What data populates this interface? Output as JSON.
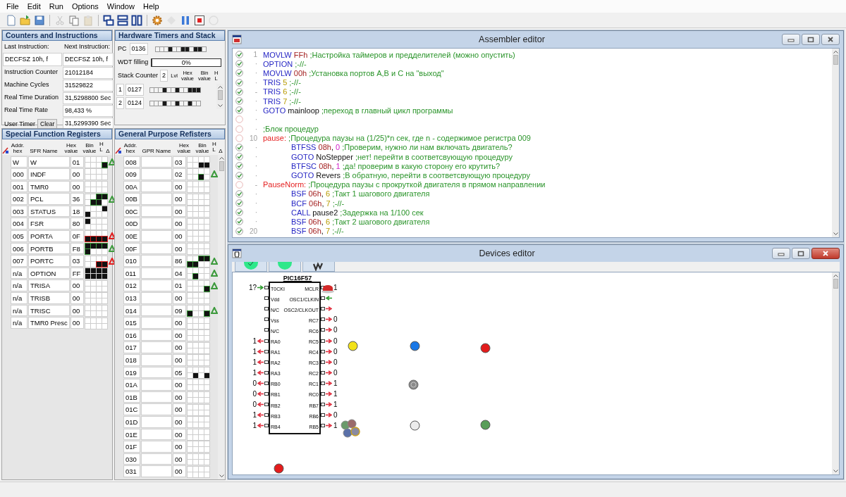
{
  "menu": [
    "File",
    "Edit",
    "Run",
    "Options",
    "Window",
    "Help"
  ],
  "toolbar": [
    {
      "kind": "new",
      "disabled": false
    },
    {
      "kind": "open",
      "disabled": false
    },
    {
      "kind": "save",
      "disabled": false
    },
    {
      "kind": "separator"
    },
    {
      "kind": "cut",
      "disabled": true
    },
    {
      "kind": "copy",
      "disabled": false
    },
    {
      "kind": "paste",
      "disabled": true
    },
    {
      "kind": "separator"
    },
    {
      "kind": "cascade",
      "disabled": false
    },
    {
      "kind": "tile_h",
      "disabled": false
    },
    {
      "kind": "tile_v",
      "disabled": false
    },
    {
      "kind": "separator"
    },
    {
      "kind": "settings",
      "disabled": false
    },
    {
      "kind": "step",
      "disabled": true
    },
    {
      "kind": "pause",
      "disabled": false
    },
    {
      "kind": "record",
      "disabled": false
    },
    {
      "kind": "info",
      "disabled": true
    }
  ],
  "counters": {
    "title": "Counters and Instructions",
    "last_label": "Last Instruction:",
    "next_label": "Next Instruction:",
    "last_value": "DECFSZ 10h, f",
    "next_value": "DECFSZ 10h, f",
    "rows": [
      {
        "label": "Instruction Counter",
        "value": "21012184"
      },
      {
        "label": "Machine Cycles",
        "value": "31529822"
      },
      {
        "label": "Real Time Duration",
        "value": "31,5298800 Sec"
      },
      {
        "label": "Real Time Rate",
        "value": "98,433 %"
      }
    ],
    "user_timer": {
      "label": "User Timer",
      "button": "Clear",
      "value": "31,5299390 Sec"
    }
  },
  "hardware": {
    "title": "Hardware Timers and Stack",
    "pc_label": "PC",
    "pc_value": "0136",
    "pc_bits": [
      false,
      false,
      false,
      true,
      false,
      false,
      true,
      true,
      false,
      true,
      true,
      false
    ],
    "wdt": {
      "label": "WDT filling",
      "level": 0,
      "reading": "0%"
    },
    "stack_label": "Stack Counter",
    "stack_count": "2",
    "headers": [
      "Lvl",
      "Hex value",
      "Bin value",
      "H L"
    ],
    "stack": [
      {
        "level_text": "1",
        "value": "0127",
        "bits": [
          false,
          false,
          false,
          true,
          false,
          false,
          true,
          false,
          false,
          true,
          true,
          true
        ]
      },
      {
        "level_text": "2",
        "value": "0124",
        "bits": [
          false,
          false,
          false,
          true,
          false,
          false,
          true,
          false,
          false,
          true,
          false,
          false
        ]
      }
    ]
  },
  "sfr": {
    "title": "Special Function Registers",
    "headers": [
      "Addr. hex",
      "SFR Name",
      "Hex value",
      "Bin value",
      "H L",
      "Δ"
    ],
    "rows": [
      {
        "addr": "W",
        "name": "W",
        "hex": "01",
        "bits": [
          false,
          false,
          false,
          false,
          false,
          false,
          false,
          true
        ],
        "changed": true,
        "color": "#3c9a3c"
      },
      {
        "addr": "000",
        "name": "INDF",
        "hex": "00",
        "bits": [
          false,
          false,
          false,
          false,
          false,
          false,
          false,
          false
        ],
        "changed": false
      },
      {
        "addr": "001",
        "name": "TMR0",
        "hex": "00",
        "bits": [
          false,
          false,
          false,
          false,
          false,
          false,
          false,
          false
        ],
        "changed": false
      },
      {
        "addr": "002",
        "name": "PCL",
        "hex": "36",
        "bits": [
          false,
          false,
          true,
          true,
          false,
          true,
          true,
          false
        ],
        "changed": true,
        "color": "#3c9a3c"
      },
      {
        "addr": "003",
        "name": "STATUS",
        "hex": "18",
        "bits": [
          false,
          false,
          false,
          true,
          true,
          false,
          false,
          false
        ],
        "changed": false
      },
      {
        "addr": "004",
        "name": "FSR",
        "hex": "80",
        "bits": [
          true,
          false,
          false,
          false,
          false,
          false,
          false,
          false
        ],
        "changed": false
      },
      {
        "addr": "005",
        "name": "PORTA",
        "hex": "0F",
        "bits": [
          false,
          false,
          false,
          false,
          true,
          true,
          true,
          true
        ],
        "changed": true,
        "color": "#e02020"
      },
      {
        "addr": "006",
        "name": "PORTB",
        "hex": "F8",
        "bits": [
          true,
          true,
          true,
          true,
          true,
          false,
          false,
          false
        ],
        "changed": true,
        "color": "#3c9a3c"
      },
      {
        "addr": "007",
        "name": "PORTC",
        "hex": "03",
        "bits": [
          false,
          false,
          false,
          false,
          false,
          false,
          true,
          true
        ],
        "changed": true,
        "color": "#e02020"
      },
      {
        "addr": "n/a",
        "name": "OPTION",
        "hex": "FF",
        "bits": [
          true,
          true,
          true,
          true,
          true,
          true,
          true,
          true
        ],
        "changed": false
      },
      {
        "addr": "n/a",
        "name": "TRISA",
        "hex": "00",
        "bits": [
          false,
          false,
          false,
          false,
          false,
          false,
          false,
          false
        ],
        "changed": false
      },
      {
        "addr": "n/a",
        "name": "TRISB",
        "hex": "00",
        "bits": [
          false,
          false,
          false,
          false,
          false,
          false,
          false,
          false
        ],
        "changed": false
      },
      {
        "addr": "n/a",
        "name": "TRISC",
        "hex": "00",
        "bits": [
          false,
          false,
          false,
          false,
          false,
          false,
          false,
          false
        ],
        "changed": false
      },
      {
        "addr": "n/a",
        "name": "TMR0 Presc",
        "hex": "00",
        "bits": [
          false,
          false,
          false,
          false,
          false,
          false,
          false,
          false
        ],
        "changed": false
      }
    ]
  },
  "gpr": {
    "title": "General Purpose Refisters",
    "headers": [
      "Addr. hex",
      "GPR Name",
      "Hex value",
      "Bin value",
      "H L",
      "Δ"
    ],
    "rows": [
      {
        "addr": "008",
        "hex": "03",
        "bits": [
          false,
          false,
          false,
          false,
          false,
          false,
          true,
          true
        ],
        "changed": false
      },
      {
        "addr": "009",
        "hex": "02",
        "bits": [
          false,
          false,
          false,
          false,
          false,
          false,
          true,
          false
        ],
        "changed": true,
        "color": "#3c9a3c"
      },
      {
        "addr": "00A",
        "hex": "00",
        "bits": [
          false,
          false,
          false,
          false,
          false,
          false,
          false,
          false
        ],
        "changed": false
      },
      {
        "addr": "00B",
        "hex": "00",
        "bits": [
          false,
          false,
          false,
          false,
          false,
          false,
          false,
          false
        ],
        "changed": false
      },
      {
        "addr": "00C",
        "hex": "00",
        "bits": [
          false,
          false,
          false,
          false,
          false,
          false,
          false,
          false
        ],
        "changed": false
      },
      {
        "addr": "00D",
        "hex": "00",
        "bits": [
          false,
          false,
          false,
          false,
          false,
          false,
          false,
          false
        ],
        "changed": false
      },
      {
        "addr": "00E",
        "hex": "00",
        "bits": [
          false,
          false,
          false,
          false,
          false,
          false,
          false,
          false
        ],
        "changed": false
      },
      {
        "addr": "00F",
        "hex": "00",
        "bits": [
          false,
          false,
          false,
          false,
          false,
          false,
          false,
          false
        ],
        "changed": false
      },
      {
        "addr": "010",
        "hex": "86",
        "bits": [
          false,
          false,
          true,
          true,
          true,
          true,
          false,
          false
        ],
        "changed": true,
        "color": "#3c9a3c"
      },
      {
        "addr": "011",
        "hex": "04",
        "bits": [
          false,
          false,
          false,
          false,
          false,
          true,
          false,
          false
        ],
        "changed": true,
        "color": "#3c9a3c"
      },
      {
        "addr": "012",
        "hex": "01",
        "bits": [
          false,
          false,
          false,
          false,
          false,
          false,
          false,
          true
        ],
        "changed": true,
        "color": "#3c9a3c"
      },
      {
        "addr": "013",
        "hex": "00",
        "bits": [
          false,
          false,
          false,
          false,
          false,
          false,
          false,
          false
        ],
        "changed": false
      },
      {
        "addr": "014",
        "hex": "09",
        "bits": [
          false,
          false,
          false,
          false,
          true,
          false,
          false,
          true
        ],
        "changed": true,
        "color": "#3c9a3c"
      },
      {
        "addr": "015",
        "hex": "00",
        "bits": [
          false,
          false,
          false,
          false,
          false,
          false,
          false,
          false
        ],
        "changed": false
      },
      {
        "addr": "016",
        "hex": "00",
        "bits": [
          false,
          false,
          false,
          false,
          false,
          false,
          false,
          false
        ],
        "changed": false
      },
      {
        "addr": "017",
        "hex": "00",
        "bits": [
          false,
          false,
          false,
          false,
          false,
          false,
          false,
          false
        ],
        "changed": false
      },
      {
        "addr": "018",
        "hex": "00",
        "bits": [
          false,
          false,
          false,
          false,
          false,
          false,
          false,
          false
        ],
        "changed": false
      },
      {
        "addr": "019",
        "hex": "05",
        "bits": [
          false,
          false,
          false,
          false,
          false,
          true,
          false,
          true
        ],
        "changed": false
      },
      {
        "addr": "01A",
        "hex": "00",
        "bits": [
          false,
          false,
          false,
          false,
          false,
          false,
          false,
          false
        ],
        "changed": false
      },
      {
        "addr": "01B",
        "hex": "00",
        "bits": [
          false,
          false,
          false,
          false,
          false,
          false,
          false,
          false
        ],
        "changed": false
      },
      {
        "addr": "01C",
        "hex": "00",
        "bits": [
          false,
          false,
          false,
          false,
          false,
          false,
          false,
          false
        ],
        "changed": false
      },
      {
        "addr": "01D",
        "hex": "00",
        "bits": [
          false,
          false,
          false,
          false,
          false,
          false,
          false,
          false
        ],
        "changed": false
      },
      {
        "addr": "01E",
        "hex": "00",
        "bits": [
          false,
          false,
          false,
          false,
          false,
          false,
          false,
          false
        ],
        "changed": false
      },
      {
        "addr": "01F",
        "hex": "00",
        "bits": [
          false,
          false,
          false,
          false,
          false,
          false,
          false,
          false
        ],
        "changed": false
      },
      {
        "addr": "030",
        "hex": "00",
        "bits": [
          false,
          false,
          false,
          false,
          false,
          false,
          false,
          false
        ],
        "changed": false
      },
      {
        "addr": "031",
        "hex": "00",
        "bits": [
          false,
          false,
          false,
          false,
          false,
          false,
          false,
          false
        ],
        "changed": false
      }
    ]
  },
  "assembler": {
    "title": "Assembler editor",
    "active": false,
    "lines": [
      {
        "compiled": true,
        "number": "1",
        "indent": false,
        "tokens": [
          {
            "kind": "op",
            "text": "MOVLW "
          },
          {
            "kind": "reg",
            "text": "FFh "
          },
          {
            "kind": "comment",
            "text": ";Настройка таймеров и предделителей (можно опустить)"
          }
        ]
      },
      {
        "compiled": true,
        "number": "·",
        "indent": false,
        "tokens": [
          {
            "kind": "op",
            "text": "OPTION "
          },
          {
            "kind": "comment",
            "text": ";-//-"
          }
        ]
      },
      {
        "compiled": true,
        "number": "·",
        "indent": false,
        "tokens": [
          {
            "kind": "op",
            "text": "MOVLW "
          },
          {
            "kind": "reg",
            "text": "00h "
          },
          {
            "kind": "comment",
            "text": ";Установка портов A,B и C на \"выход\""
          }
        ]
      },
      {
        "compiled": true,
        "number": "·",
        "indent": false,
        "tokens": [
          {
            "kind": "op",
            "text": "TRIS "
          },
          {
            "kind": "lit",
            "text": "5 "
          },
          {
            "kind": "comment",
            "text": ";-//-"
          }
        ]
      },
      {
        "compiled": true,
        "number": "-",
        "indent": false,
        "tokens": [
          {
            "kind": "op",
            "text": "TRIS "
          },
          {
            "kind": "lit",
            "text": "6 "
          },
          {
            "kind": "comment",
            "text": ";-//-"
          }
        ]
      },
      {
        "compiled": true,
        "number": "·",
        "indent": false,
        "tokens": [
          {
            "kind": "op",
            "text": "TRIS "
          },
          {
            "kind": "lit",
            "text": "7 "
          },
          {
            "kind": "comment",
            "text": ";-//-"
          }
        ]
      },
      {
        "compiled": true,
        "number": "·",
        "indent": false,
        "tokens": [
          {
            "kind": "op",
            "text": "GOTO "
          },
          {
            "kind": "ident",
            "text": "mainloop "
          },
          {
            "kind": "comment",
            "text": ";переход в главный цикл программы"
          }
        ]
      },
      {
        "compiled": false,
        "number": "·"
      },
      {
        "compiled": false,
        "number": "·",
        "indent": false,
        "tokens": [
          {
            "kind": "comment",
            "text": ";Блок процедур"
          }
        ]
      },
      {
        "compiled": false,
        "number": "10",
        "indent": false,
        "tokens": [
          {
            "kind": "label",
            "text": "pause: "
          },
          {
            "kind": "comment",
            "text": ";Процедура паузы на (1/25)*n сек, где n - содержимое регистра 009"
          }
        ]
      },
      {
        "compiled": true,
        "number": "·",
        "indent": true,
        "tokens": [
          {
            "kind": "op",
            "text": "BTFSS "
          },
          {
            "kind": "reg",
            "text": "08h"
          },
          {
            "kind": "text",
            "text": ", "
          },
          {
            "kind": "bit",
            "text": "0 "
          },
          {
            "kind": "comment",
            "text": ";Проверим, нужно ли нам включать двигатель?"
          }
        ]
      },
      {
        "compiled": true,
        "number": "·",
        "indent": true,
        "tokens": [
          {
            "kind": "op",
            "text": "GOTO "
          },
          {
            "kind": "ident",
            "text": "NoStepper "
          },
          {
            "kind": "comment",
            "text": ";нет! перейти в соответсвующую процедуру"
          }
        ]
      },
      {
        "compiled": true,
        "number": "·",
        "indent": true,
        "tokens": [
          {
            "kind": "op",
            "text": "BTFSC "
          },
          {
            "kind": "reg",
            "text": "08h"
          },
          {
            "kind": "text",
            "text": ", "
          },
          {
            "kind": "bit",
            "text": "1 "
          },
          {
            "kind": "comment",
            "text": ";да! проверим в какую сторону его крутить?"
          }
        ]
      },
      {
        "compiled": true,
        "number": "·",
        "indent": true,
        "tokens": [
          {
            "kind": "op",
            "text": "GOTO "
          },
          {
            "kind": "ident",
            "text": "Revers "
          },
          {
            "kind": "comment",
            "text": ";В обратную, перейти в соответсвующую процедуру"
          }
        ]
      },
      {
        "compiled": false,
        "number": "-",
        "indent": false,
        "tokens": [
          {
            "kind": "label",
            "text": "PauseNorm: "
          },
          {
            "kind": "comment",
            "text": ";Процедура паузы с прокруткой двигателя в прямом направлении"
          }
        ]
      },
      {
        "compiled": true,
        "number": "·",
        "indent": true,
        "tokens": [
          {
            "kind": "op",
            "text": "BSF "
          },
          {
            "kind": "reg",
            "text": "06h"
          },
          {
            "kind": "text",
            "text": ", "
          },
          {
            "kind": "lit",
            "text": "6 "
          },
          {
            "kind": "comment",
            "text": ";Такт 1 шагового двигателя"
          }
        ]
      },
      {
        "compiled": true,
        "number": "·",
        "indent": true,
        "tokens": [
          {
            "kind": "op",
            "text": "BCF "
          },
          {
            "kind": "reg",
            "text": "06h"
          },
          {
            "kind": "text",
            "text": ", "
          },
          {
            "kind": "lit",
            "text": "7 "
          },
          {
            "kind": "comment",
            "text": ";-//-"
          }
        ]
      },
      {
        "compiled": true,
        "number": "·",
        "indent": true,
        "tokens": [
          {
            "kind": "op",
            "text": "CALL "
          },
          {
            "kind": "ident",
            "text": "pause2 "
          },
          {
            "kind": "comment",
            "text": ";Задержка на 1/100 сек"
          }
        ]
      },
      {
        "compiled": true,
        "number": "·",
        "indent": true,
        "tokens": [
          {
            "kind": "op",
            "text": "BSF "
          },
          {
            "kind": "reg",
            "text": "06h"
          },
          {
            "kind": "text",
            "text": ", "
          },
          {
            "kind": "lit",
            "text": "6 "
          },
          {
            "kind": "comment",
            "text": ";Такт 2 шагового двигателя"
          }
        ]
      },
      {
        "compiled": true,
        "number": "20",
        "indent": true,
        "tokens": [
          {
            "kind": "op",
            "text": "BSF "
          },
          {
            "kind": "reg",
            "text": "06h"
          },
          {
            "kind": "text",
            "text": ", "
          },
          {
            "kind": "lit",
            "text": "7 "
          },
          {
            "kind": "comment",
            "text": ";-//-"
          }
        ]
      }
    ]
  },
  "devices": {
    "title": "Devices editor",
    "active": true,
    "chip": {
      "name": "PIC16F57",
      "left_pins": [
        {
          "label": "T0CKI",
          "value": "1?",
          "kind": "input"
        },
        {
          "label": "Vdd",
          "kind": "passive"
        },
        {
          "label": "N/C",
          "kind": "passive"
        },
        {
          "label": "Vss",
          "kind": "passive"
        },
        {
          "label": "N/C",
          "kind": "passive"
        },
        {
          "label": "RA0",
          "value": "1",
          "kind": "output"
        },
        {
          "label": "RA1",
          "value": "1",
          "kind": "output"
        },
        {
          "label": "RA2",
          "value": "1",
          "kind": "output"
        },
        {
          "label": "RA3",
          "value": "1",
          "kind": "output"
        },
        {
          "label": "RB0",
          "value": "0",
          "kind": "output"
        },
        {
          "label": "RB1",
          "value": "0",
          "kind": "output"
        },
        {
          "label": "RB2",
          "value": "0",
          "kind": "output"
        },
        {
          "label": "RB3",
          "value": "1",
          "kind": "output"
        },
        {
          "label": "RB4",
          "value": "1",
          "kind": "output"
        }
      ],
      "right_pins": [
        {
          "label": "MCLR",
          "value": "1",
          "kind": "input"
        },
        {
          "label": "OSC1/CLKIN",
          "kind": "input"
        },
        {
          "label": "OSC2/CLKOUT",
          "kind": "output"
        },
        {
          "label": "RC7",
          "value": "0",
          "kind": "output"
        },
        {
          "label": "RC6",
          "value": "0",
          "kind": "output"
        },
        {
          "label": "RC5",
          "value": "0",
          "kind": "output"
        },
        {
          "label": "RC4",
          "value": "0",
          "kind": "output"
        },
        {
          "label": "RC3",
          "value": "0",
          "kind": "output"
        },
        {
          "label": "RC2",
          "value": "0",
          "kind": "output"
        },
        {
          "label": "RC1",
          "value": "1",
          "kind": "output"
        },
        {
          "label": "RC0",
          "value": "1",
          "kind": "output"
        },
        {
          "label": "RB7",
          "value": "1",
          "kind": "output"
        },
        {
          "label": "RB6",
          "value": "0",
          "kind": "output"
        },
        {
          "label": "RB5",
          "value": "1",
          "kind": "output"
        }
      ]
    },
    "items": [
      {
        "kind": "dome_button",
        "color": "#d42a2a"
      },
      {
        "kind": "led",
        "color": "#f2e21a"
      },
      {
        "kind": "led",
        "color": "#1a78e6"
      },
      {
        "kind": "led",
        "color": "#e21c1c"
      },
      {
        "kind": "round_button",
        "color": "#8a8a8a"
      },
      {
        "kind": "button_cluster"
      },
      {
        "kind": "led",
        "color": "#ececec"
      },
      {
        "kind": "led",
        "color": "#5a9e5a"
      },
      {
        "kind": "led",
        "color": "#e41c1c"
      }
    ]
  }
}
